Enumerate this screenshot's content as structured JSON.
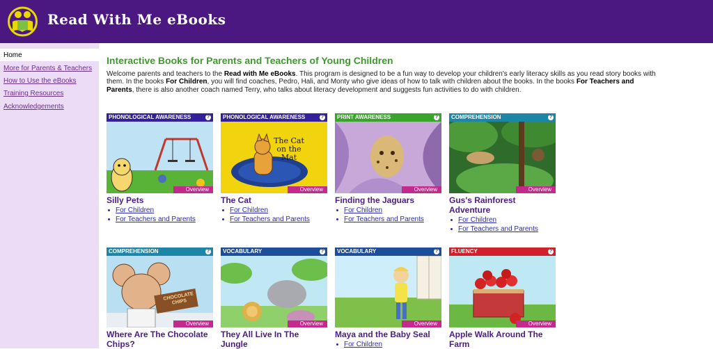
{
  "header": {
    "title": "Read With Me eBooks"
  },
  "sidebar": {
    "items": [
      {
        "label": "Home"
      },
      {
        "label": "More for Parents & Teachers"
      },
      {
        "label": "How to Use the eBooks"
      },
      {
        "label": "Training Resources"
      },
      {
        "label": "Acknowledgements"
      }
    ]
  },
  "main": {
    "title": "Interactive Books for Parents and Teachers of Young Children",
    "intro": {
      "t1": "Welcome parents and teachers to the ",
      "b1": "Read with Me eBooks",
      "t2": ". This program is designed to be a fun way to develop your children's early literacy skills as you read story books with them. In the books ",
      "b2": "For Children",
      "t3": ", you will find coaches, Pedro, Hali, and Monty who give ideas of how to talk with children about the books. In the books ",
      "b3": "For Teachers and Parents",
      "t4": ", there is also another coach named Terry, who talks about literacy development and suggests fun activities to do with children."
    },
    "overview_label": "Overview",
    "help_label": "?",
    "cards": [
      {
        "category": "PHONOLOGICAL AWARENESS",
        "category_color": "#34209a",
        "title": "Silly Pets",
        "links": [
          "For Children",
          "For Teachers and Parents"
        ]
      },
      {
        "category": "PHONOLOGICAL AWARENESS",
        "category_color": "#34209a",
        "title": "The Cat",
        "cover_text": "The Cat on the Mat",
        "links": [
          "For Children",
          "For Teachers and Parents"
        ]
      },
      {
        "category": "PRINT AWARENESS",
        "category_color": "#3aa52c",
        "title": "Finding the Jaguars",
        "links": [
          "For Children",
          "For Teachers and Parents"
        ]
      },
      {
        "category": "COMPREHENSION",
        "category_color": "#1d86a6",
        "title": "Gus's Rainforest Adventure",
        "links": [
          "For Children",
          "For Teachers and Parents"
        ]
      },
      {
        "category": "COMPREHENSION",
        "category_color": "#1d86a6",
        "title": "Where Are The Chocolate Chips?",
        "cover_text": "CHOCOLATE CHIPS",
        "links": []
      },
      {
        "category": "VOCABULARY",
        "category_color": "#1e4d9a",
        "title": "They All Live In The Jungle",
        "links": []
      },
      {
        "category": "VOCABULARY",
        "category_color": "#1e4d9a",
        "title": "Maya and the Baby Seal",
        "links": [
          "For Children"
        ]
      },
      {
        "category": "FLUENCY",
        "category_color": "#d0202c",
        "title": "Apple Walk Around The Farm",
        "links": []
      }
    ]
  }
}
